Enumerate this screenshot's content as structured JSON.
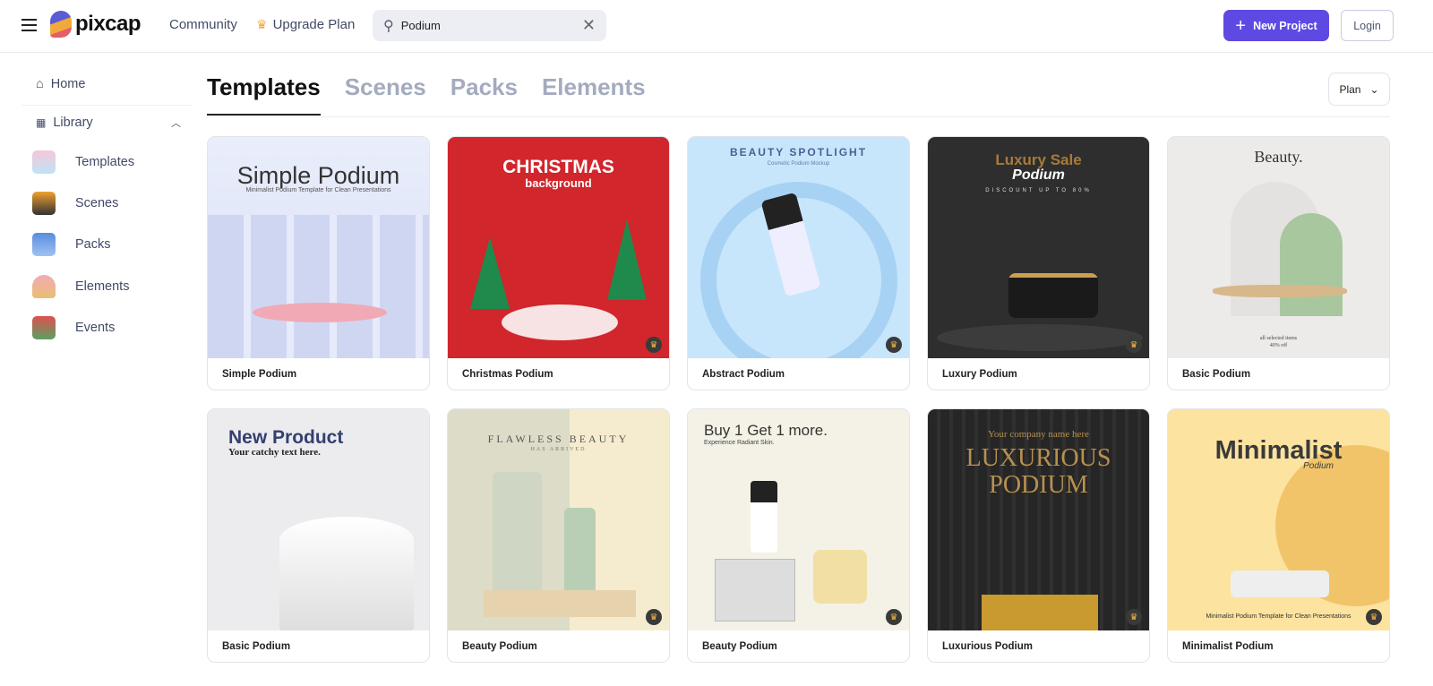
{
  "header": {
    "brand": "pixcap",
    "nav": {
      "community": "Community",
      "upgrade": "Upgrade Plan"
    },
    "search": {
      "value": "Podium",
      "placeholder": "Search"
    },
    "new_project": "New Project",
    "login": "Login",
    "accent": "#5e4ae3"
  },
  "sidebar": {
    "home": "Home",
    "library": "Library",
    "items": [
      {
        "label": "Templates"
      },
      {
        "label": "Scenes"
      },
      {
        "label": "Packs"
      },
      {
        "label": "Elements"
      },
      {
        "label": "Events"
      }
    ]
  },
  "main": {
    "tabs": [
      {
        "label": "Templates",
        "active": true
      },
      {
        "label": "Scenes"
      },
      {
        "label": "Packs"
      },
      {
        "label": "Elements"
      }
    ],
    "plan_filter": "Plan",
    "cards": [
      {
        "title": "Simple Podium",
        "lines": [
          "Simple Podium",
          "Minimalist Podium Template for Clean Presentations",
          ""
        ],
        "premium": false,
        "bg": "#e9eefb"
      },
      {
        "title": "Christmas Podium",
        "lines": [
          "CHRISTMAS",
          "background",
          ""
        ],
        "premium": true,
        "bg": "#d0262c"
      },
      {
        "title": "Abstract Podium",
        "lines": [
          "BEAUTY SPOTLIGHT",
          "Cosmetic Podium Mockup",
          ""
        ],
        "premium": true,
        "bg": "#c8e6fb"
      },
      {
        "title": "Luxury Podium",
        "lines": [
          "Luxury Sale",
          "Podium",
          "DISCOUNT UP TO 80%"
        ],
        "premium": true,
        "bg": "#2e2e2e"
      },
      {
        "title": "Basic Podium",
        "lines": [
          "Beauty.",
          "all selected items",
          "40% off"
        ],
        "premium": false,
        "bg": "#ecebea"
      },
      {
        "title": "Basic Podium",
        "lines": [
          "New Product",
          "Your catchy text here.",
          ""
        ],
        "premium": false,
        "bg": "#ececef"
      },
      {
        "title": "Beauty Podium",
        "lines": [
          "FLAWLESS BEAUTY",
          "HAS ARRIVED",
          ""
        ],
        "premium": true,
        "bg": "#dcdcc8"
      },
      {
        "title": "Beauty Podium",
        "lines": [
          "Buy 1 Get 1 more.",
          "Experience Radiant Skin.",
          ""
        ],
        "premium": true,
        "bg": "#f4f2e6"
      },
      {
        "title": "Luxurious Podium",
        "lines": [
          "Your company name here",
          "LUXURIOUS PODIUM",
          ""
        ],
        "premium": true,
        "bg": "#262626"
      },
      {
        "title": "Minimalist Podium",
        "lines": [
          "Minimalist",
          "Podium",
          "Minimalist Podium Template for Clean Presentations"
        ],
        "premium": true,
        "bg": "#fde3a0"
      }
    ]
  }
}
